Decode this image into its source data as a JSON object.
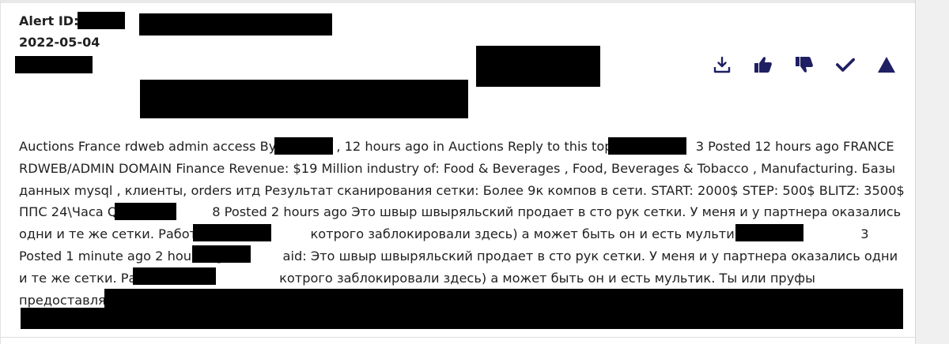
{
  "alert": {
    "id_label": "Alert ID:",
    "date": "2022-05-04"
  },
  "actions": [
    {
      "icon": "download-icon",
      "label": "Download"
    },
    {
      "icon": "thumbs-up-icon",
      "label": "Relevant"
    },
    {
      "icon": "thumbs-down-icon",
      "label": "Not relevant"
    },
    {
      "icon": "check-icon",
      "label": "Mark reviewed"
    },
    {
      "icon": "triangle-up-icon",
      "label": "Collapse"
    }
  ],
  "colors": {
    "accent": "#1f1f63",
    "text": "#212121",
    "redaction": "#000000"
  },
  "post": {
    "s1": "Auctions France rdweb admin access By",
    "s2": ", 12 hours ago in Auctions Reply to this top",
    "s3": " 3 Posted 12 hours ago FRANCE RDWEB/ADMIN DOMAIN Finance Revenue: $19 Million industry of: Food & Beverages , Food, Beverages & Tobacco , Manufacturing. Базы данных mysql , клиенты, orders итд Результат сканирования сетки: Более 9к компов в сети. START: 2000$ STEP: 500$ BLITZ: 3500$ ППС 24\\Часа Quote",
    "s4": " 8 Posted 2 hours ago Это швыр швыряльский продает в сто рук сетки. У меня и у партнера оказались одни и те же сетки. Работает с",
    "s5": "котрого заблокировали здесь) а может быть он и есть мультик. Quote",
    "s6": " 3 Posted 1 minute ago  2 hours ago,",
    "s7": "aid: Это швыр швыряльский продает в сто рук сетки. У меня и у партнера оказались одни и те же сетки. Работает с",
    "s8": "котрого заблокировали здесь) а может быть он и есть мультик. Ты или пруфы предоставляеш или нахуй топай."
  }
}
